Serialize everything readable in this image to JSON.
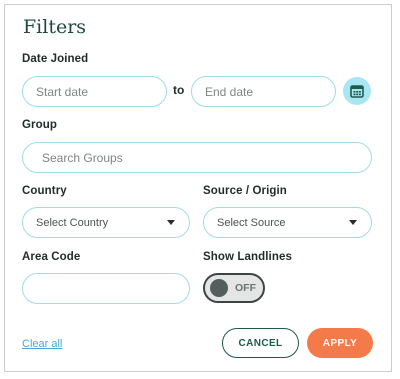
{
  "title": "Filters",
  "date_joined": {
    "label": "Date Joined",
    "start_placeholder": "Start date",
    "to_text": "to",
    "end_placeholder": "End date",
    "calendar_icon": "calendar-icon"
  },
  "group": {
    "label": "Group",
    "placeholder": "Search Groups"
  },
  "country": {
    "label": "Country",
    "selected": "Select Country"
  },
  "source": {
    "label": "Source / Origin",
    "selected": "Select Source"
  },
  "area_code": {
    "label": "Area Code",
    "value": ""
  },
  "landlines": {
    "label": "Show Landlines",
    "state": "OFF"
  },
  "actions": {
    "clear_all": "Clear all",
    "cancel": "CANCEL",
    "apply": "APPLY"
  },
  "colors": {
    "title": "#1e4a3e",
    "field_border": "#9fdcea",
    "calendar_bg": "#a8e6f2",
    "apply_bg": "#f47a4a",
    "cancel_border": "#1e5b4a",
    "link": "#4aa7d4"
  }
}
